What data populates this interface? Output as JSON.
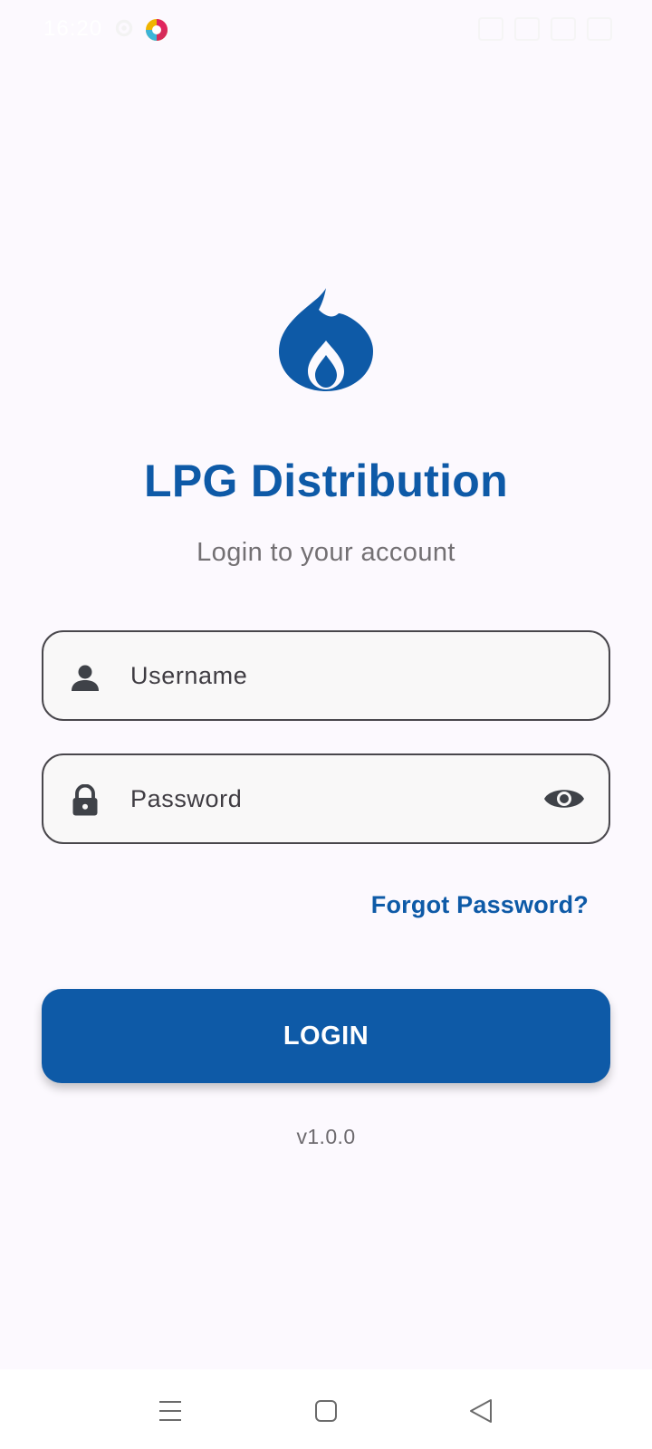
{
  "status_bar": {
    "time": "16:20",
    "icons": [
      "gear-icon",
      "app-icon",
      "signal-icon",
      "wifi-icon",
      "battery-icon"
    ]
  },
  "app": {
    "title": "LPG Distribution",
    "subtitle": "Login to your account",
    "logo": "flame-logo",
    "accent_color": "#0e5aa7"
  },
  "form": {
    "username": {
      "placeholder": "Username",
      "value": "",
      "icon": "person-icon"
    },
    "password": {
      "placeholder": "Password",
      "value": "",
      "icon": "lock-icon",
      "toggle_icon": "eye-icon"
    },
    "forgot_label": "Forgot Password?",
    "login_label": "LOGIN"
  },
  "footer": {
    "version": "v1.0.0"
  },
  "nav_bar": {
    "items": [
      "menu-icon",
      "home-icon",
      "back-icon"
    ]
  }
}
